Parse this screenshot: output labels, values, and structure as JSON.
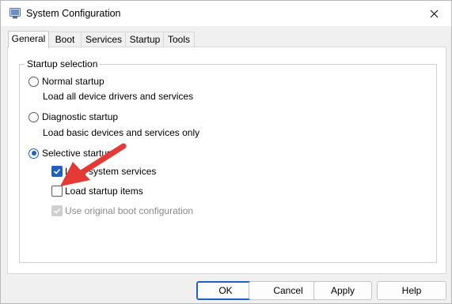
{
  "window": {
    "title": "System Configuration"
  },
  "tabs": [
    "General",
    "Boot",
    "Services",
    "Startup",
    "Tools"
  ],
  "startup_selection": {
    "legend": "Startup selection",
    "normal": {
      "label": "Normal startup",
      "desc": "Load all device drivers and services"
    },
    "diagnostic": {
      "label": "Diagnostic startup",
      "desc": "Load basic devices and services only"
    },
    "selective": {
      "label": "Selective startup"
    },
    "options": {
      "load_system_services": "Load system services",
      "load_startup_items": "Load startup items",
      "use_original_boot": "Use original boot configuration"
    },
    "selected": "selective",
    "load_system_services_checked": true,
    "load_startup_items_checked": false,
    "use_original_boot_checked": true
  },
  "buttons": {
    "ok": "OK",
    "cancel": "Cancel",
    "apply": "Apply",
    "help": "Help"
  },
  "colors": {
    "accent": "#1f5fbf",
    "annotation_arrow": "#e53935"
  }
}
